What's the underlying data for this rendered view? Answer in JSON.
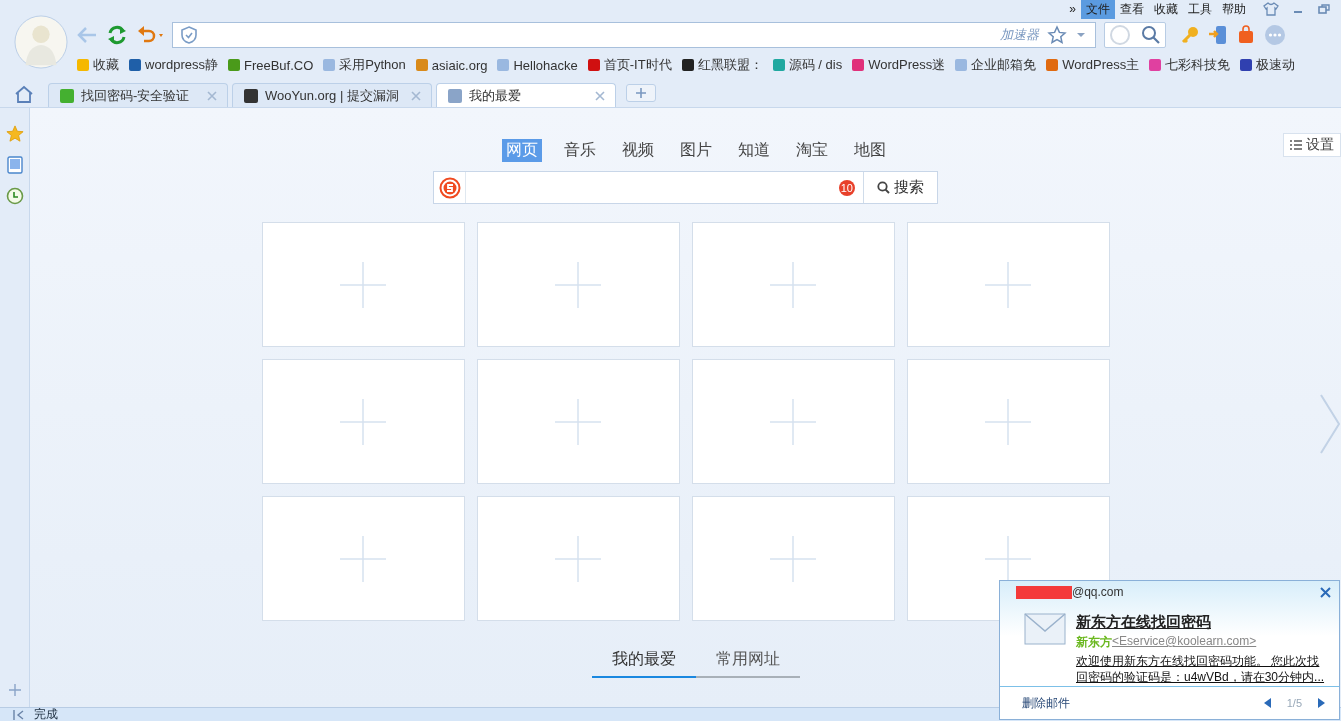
{
  "menu": [
    {
      "label": "»",
      "selected": false
    },
    {
      "label": "文件",
      "selected": true
    },
    {
      "label": "查看",
      "selected": false
    },
    {
      "label": "收藏",
      "selected": false
    },
    {
      "label": "工具",
      "selected": false
    },
    {
      "label": "帮助",
      "selected": false
    }
  ],
  "address_bar": {
    "accelerator": "加速器"
  },
  "bookmarks": [
    {
      "label": "收藏",
      "color": "#f5b800"
    },
    {
      "label": "wordpress静",
      "color": "#1f5fa8"
    },
    {
      "label": "FreeBuf.CO",
      "color": "#4a9a1a"
    },
    {
      "label": "采用Python",
      "color": "#9ab8e0"
    },
    {
      "label": "asiaic.org",
      "color": "#d98a1a"
    },
    {
      "label": "Hellohacke",
      "color": "#9ab8e0"
    },
    {
      "label": "首页-IT时代",
      "color": "#d01010"
    },
    {
      "label": "红黑联盟：",
      "color": "#222222"
    },
    {
      "label": "源码 / dis",
      "color": "#20a8a0"
    },
    {
      "label": "WordPress迷",
      "color": "#e0307a"
    },
    {
      "label": "企业邮箱免",
      "color": "#9ab8e0"
    },
    {
      "label": "WordPress主",
      "color": "#e06a10"
    },
    {
      "label": "七彩科技免",
      "color": "#e040a0"
    },
    {
      "label": "极速动",
      "color": "#3040b0"
    }
  ],
  "tabs": [
    {
      "label": "找回密码-安全验证",
      "selected": false,
      "color": "#44b030"
    },
    {
      "label": "WooYun.org | 提交漏洞",
      "selected": false,
      "color": "#333333"
    },
    {
      "label": "我的最爱",
      "selected": true,
      "color": "#8aa4c8"
    }
  ],
  "search": {
    "categories": [
      {
        "label": "网页",
        "selected": true
      },
      {
        "label": "音乐",
        "selected": false
      },
      {
        "label": "视频",
        "selected": false
      },
      {
        "label": "图片",
        "selected": false
      },
      {
        "label": "知道",
        "selected": false
      },
      {
        "label": "淘宝",
        "selected": false
      },
      {
        "label": "地图",
        "selected": false
      }
    ],
    "badge": "10",
    "button": "搜索"
  },
  "settings": "设置",
  "tiles": [
    {
      "kind": "empty"
    },
    {
      "kind": "empty"
    },
    {
      "kind": "empty"
    },
    {
      "kind": "empty"
    },
    {
      "kind": "empty"
    },
    {
      "kind": "empty"
    },
    {
      "kind": "empty"
    },
    {
      "kind": "empty"
    },
    {
      "kind": "empty"
    },
    {
      "kind": "empty"
    },
    {
      "kind": "empty"
    },
    {
      "kind": "empty"
    }
  ],
  "bottom_tabs": [
    {
      "label": "我的最爱",
      "selected": true
    },
    {
      "label": "常用网址",
      "selected": false
    }
  ],
  "notification": {
    "email_suffix": "@qq.com",
    "subject": "新东方在线找回密码",
    "sender_name": "新东方",
    "sender_address": "<Eservice@koolearn.com>",
    "preview": " 欢迎使用新东方在线找回密码功能。 您此次找回密码的验证码是：u4wVBd，请在30分钟内...",
    "delete": "删除邮件",
    "pager": "1/5"
  },
  "status_bar": "完成"
}
